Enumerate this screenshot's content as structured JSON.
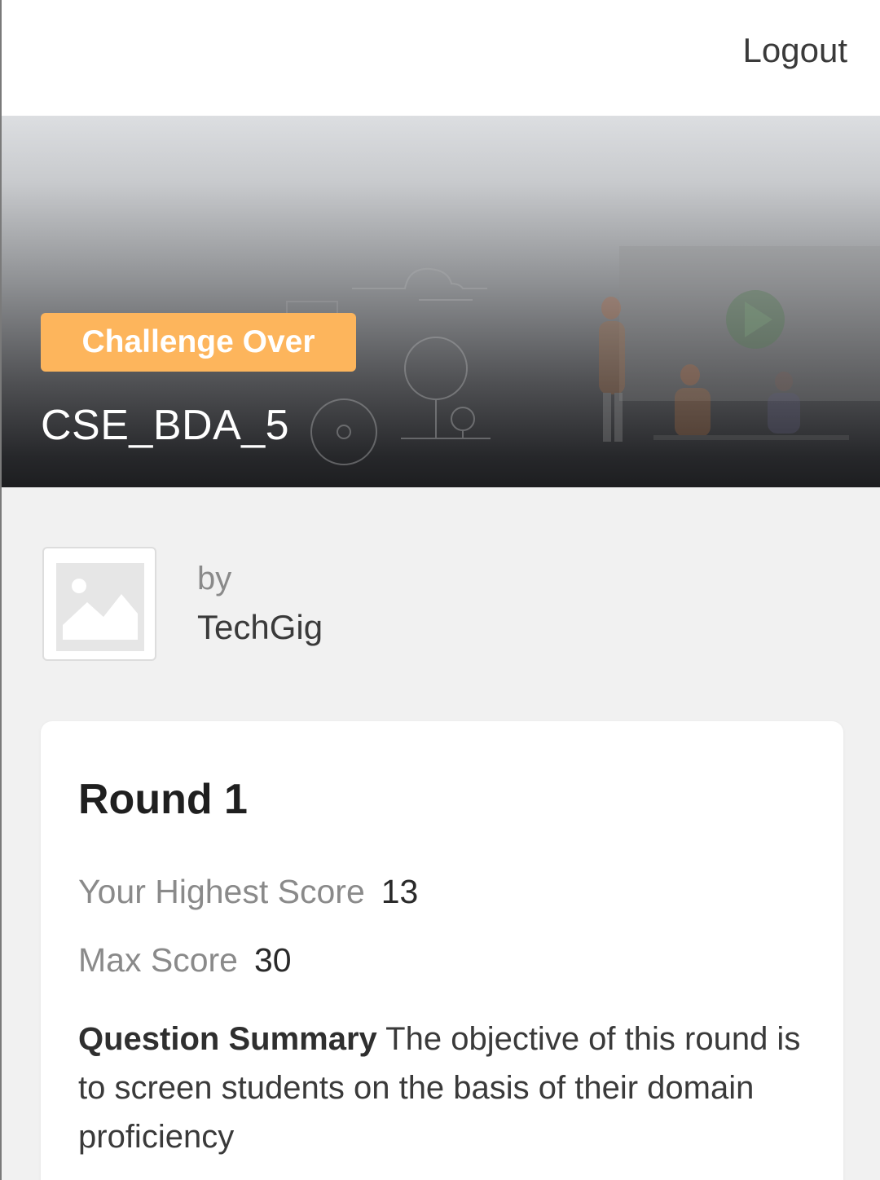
{
  "header": {
    "logout_label": "Logout"
  },
  "hero": {
    "status_badge": "Challenge Over",
    "challenge_title": "CSE_BDA_5"
  },
  "organizer": {
    "by_label": "by",
    "name": "TechGig",
    "logo_icon": "image-placeholder-icon"
  },
  "round": {
    "title": "Round 1",
    "highest_score_label": "Your Highest Score",
    "highest_score_value": "13",
    "max_score_label": "Max Score",
    "max_score_value": "30",
    "summary_label": "Question Summary",
    "summary_text": "The objective of this round is to screen students on the basis of their domain proficiency"
  },
  "colors": {
    "badge": "#fdb55c",
    "page_background": "#f1f1f1",
    "card_background": "#ffffff"
  }
}
